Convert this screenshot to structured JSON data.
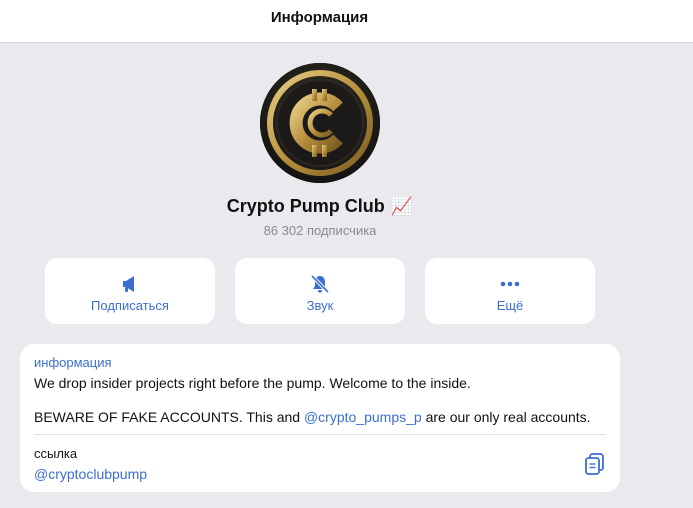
{
  "header": {
    "title": "Информация"
  },
  "channel": {
    "name": "Crypto Pump Club",
    "emoji": "📈",
    "subscribers": "86 302 подписчика"
  },
  "actions": [
    {
      "label": "Подписаться",
      "icon": "megaphone-icon"
    },
    {
      "label": "Звук",
      "icon": "bell-slash-icon"
    },
    {
      "label": "Ещё",
      "icon": "more-dots-icon"
    }
  ],
  "info": {
    "section_label": "информация",
    "description_line1": "We drop insider projects right before the pump. Welcome to the inside.",
    "description_line2_before": "BEWARE OF FAKE ACCOUNTS. This and ",
    "description_line2_mention": "@crypto_pumps_p",
    "description_line2_after": " are our only real accounts.",
    "link_label": "ссылка",
    "link_value": "@cryptoclubpump",
    "copy_icon": "copy-icon"
  },
  "colors": {
    "accent": "#3a6fd1",
    "background": "#e9e9ee",
    "card": "#ffffff",
    "gold": "#c9a44e"
  }
}
